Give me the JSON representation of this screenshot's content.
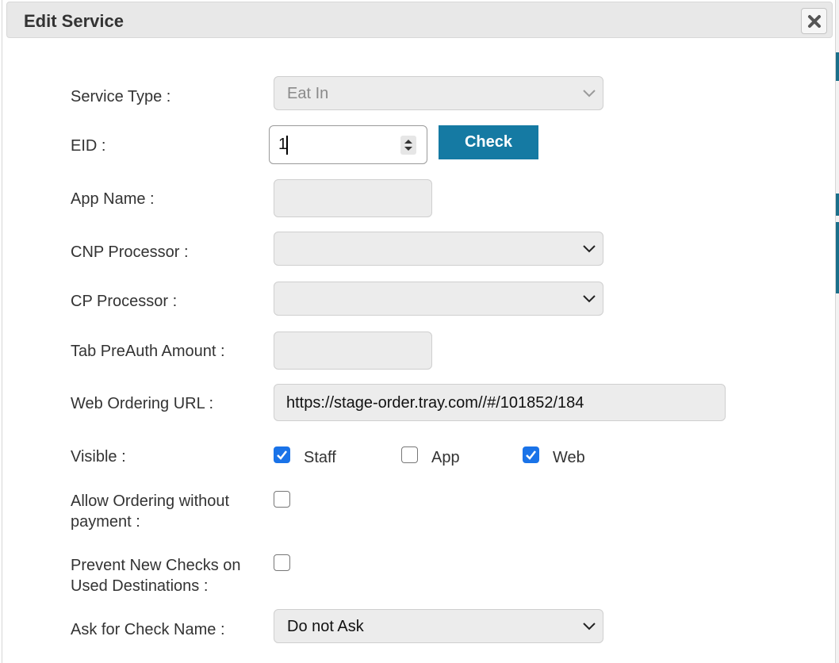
{
  "dialog": {
    "title": "Edit Service"
  },
  "icons": {
    "close": "close-icon",
    "chevron": "chevron-down-icon",
    "spinner": "spinner-icon",
    "check": "checkmark-icon"
  },
  "colors": {
    "accent": "#157aa3",
    "checkbox": "#1a73e8"
  },
  "form": {
    "service_type": {
      "label": "Service Type :",
      "value": "Eat In"
    },
    "eid": {
      "label": "EID :",
      "value": "1"
    },
    "check_button": "Check",
    "app_name": {
      "label": "App Name :",
      "value": ""
    },
    "cnp_processor": {
      "label": "CNP Processor :",
      "value": ""
    },
    "cp_processor": {
      "label": "CP Processor :",
      "value": ""
    },
    "tab_preauth": {
      "label": "Tab PreAuth Amount :",
      "value": ""
    },
    "web_url": {
      "label": "Web Ordering URL :",
      "value": "https://stage-order.tray.com//#/101852/184"
    },
    "visible": {
      "label": "Visible :",
      "options": [
        {
          "label": "Staff",
          "checked": true
        },
        {
          "label": "App",
          "checked": false
        },
        {
          "label": "Web",
          "checked": true
        }
      ]
    },
    "allow_ordering": {
      "label_line1": "Allow Ordering without",
      "label_line2": "payment :",
      "checked": false
    },
    "prevent_checks": {
      "label_line1": "Prevent New Checks on",
      "label_line2": "Used Destinations :",
      "checked": false
    },
    "ask_check_name": {
      "label": "Ask for Check Name :",
      "value": "Do not Ask"
    }
  }
}
